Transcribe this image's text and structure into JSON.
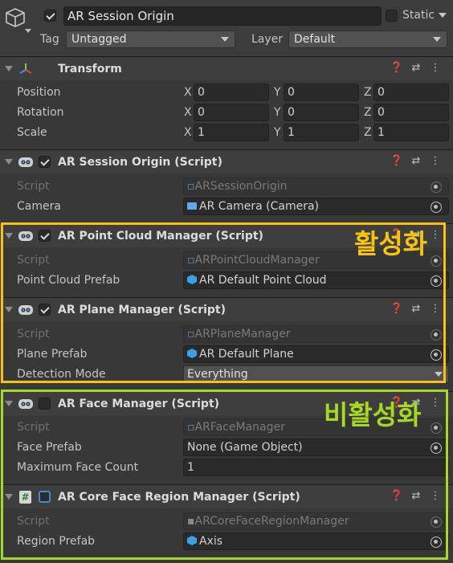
{
  "object": {
    "name": "AR Session Origin",
    "static_label": "Static",
    "tag_label": "Tag",
    "tag_value": "Untagged",
    "layer_label": "Layer",
    "layer_value": "Default"
  },
  "transform": {
    "title": "Transform",
    "rows": [
      {
        "label": "Position",
        "x": "0",
        "y": "0",
        "z": "0"
      },
      {
        "label": "Rotation",
        "x": "0",
        "y": "0",
        "z": "0"
      },
      {
        "label": "Scale",
        "x": "1",
        "y": "1",
        "z": "1"
      }
    ],
    "axis_x": "X",
    "axis_y": "Y",
    "axis_z": "Z"
  },
  "components": {
    "session_origin": {
      "title": "AR Session Origin (Script)",
      "script_label": "Script",
      "script_value": "ARSessionOrigin",
      "field_label": "Camera",
      "field_value": "AR Camera (Camera)"
    },
    "point_cloud": {
      "title": "AR Point Cloud Manager (Script)",
      "script_label": "Script",
      "script_value": "ARPointCloudManager",
      "field_label": "Point Cloud Prefab",
      "field_value": "AR Default Point Cloud"
    },
    "plane": {
      "title": "AR Plane Manager (Script)",
      "script_label": "Script",
      "script_value": "ARPlaneManager",
      "field_label": "Plane Prefab",
      "field_value": "AR Default Plane",
      "mode_label": "Detection Mode",
      "mode_value": "Everything"
    },
    "face": {
      "title": "AR Face Manager (Script)",
      "script_label": "Script",
      "script_value": "ARFaceManager",
      "field_label": "Face Prefab",
      "field_value": "None (Game Object)",
      "count_label": "Maximum Face Count",
      "count_value": "1"
    },
    "core_face": {
      "title": "AR Core Face Region Manager (Script)",
      "script_label": "Script",
      "script_value": "ARCoreFaceRegionManager",
      "field_label": "Region Prefab",
      "field_value": "Axis"
    }
  },
  "annotations": {
    "active_label": "활성화",
    "active_color": "#f6c410",
    "inactive_label": "비활성화",
    "inactive_color": "#a7d824"
  },
  "icons": {
    "help": "help-icon",
    "presets": "presets-icon",
    "menu": "kebab-menu-icon"
  }
}
